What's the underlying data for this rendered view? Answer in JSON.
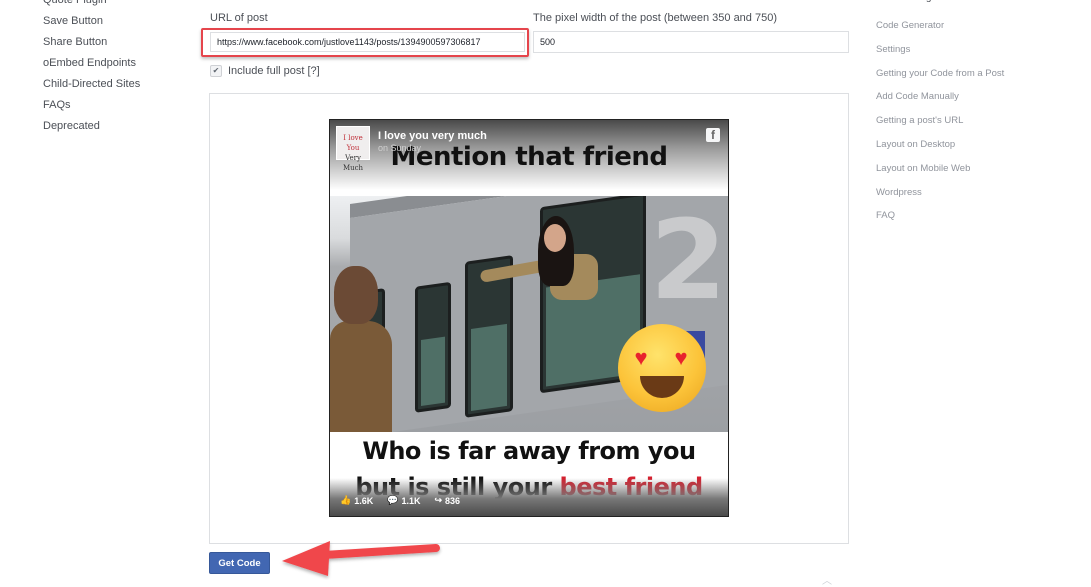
{
  "left_nav": {
    "items": [
      {
        "label": "Quote Plugin"
      },
      {
        "label": "Save Button"
      },
      {
        "label": "Share Button"
      },
      {
        "label": "oEmbed Endpoints"
      },
      {
        "label": "Child-Directed Sites"
      },
      {
        "label": "FAQs"
      },
      {
        "label": "Deprecated"
      }
    ]
  },
  "right_nav": {
    "title": "On This Page",
    "items": [
      {
        "label": "Code Generator"
      },
      {
        "label": "Settings"
      },
      {
        "label": "Getting your Code from a Post"
      },
      {
        "label": "Add Code Manually"
      },
      {
        "label": "Getting a post's URL"
      },
      {
        "label": "Layout on Desktop"
      },
      {
        "label": "Layout on Mobile Web"
      },
      {
        "label": "Wordpress"
      },
      {
        "label": "FAQ"
      }
    ]
  },
  "form": {
    "url_label": "URL of post",
    "url_value": "https://www.facebook.com/justlove1143/posts/1394900597306817",
    "width_label": "The pixel width of the post (between 350 and 750)",
    "width_value": "500",
    "include_full_post": {
      "label": "Include full post",
      "help": "[?]",
      "checked": true,
      "check_glyph": "✔"
    }
  },
  "post": {
    "page_name": "I love you very much",
    "time": "on Sunday",
    "avatar_text": "I love You",
    "avatar_subtext": "Very Much",
    "fb_icon": "f",
    "caption_top": "Mention that friend",
    "caption_bottom_line1": "Who is far away from you",
    "caption_bottom_line2": "but is still your",
    "caption_bottom_highlight": "best friend",
    "photo_number": "2",
    "stats": {
      "likes": "1.6K",
      "comments": "1.1K",
      "shares": "836"
    },
    "icons": {
      "like": "👍",
      "comment": "💬",
      "share": "↪",
      "heart": "♥"
    }
  },
  "actions": {
    "get_code_label": "Get Code",
    "scroll_up_glyph": "︿"
  },
  "annotations": {
    "highlight_color": "#e5454c",
    "arrow_color": "#f0464c"
  },
  "colors": {
    "button_bg": "#4267b2",
    "text_muted": "#90949c"
  }
}
